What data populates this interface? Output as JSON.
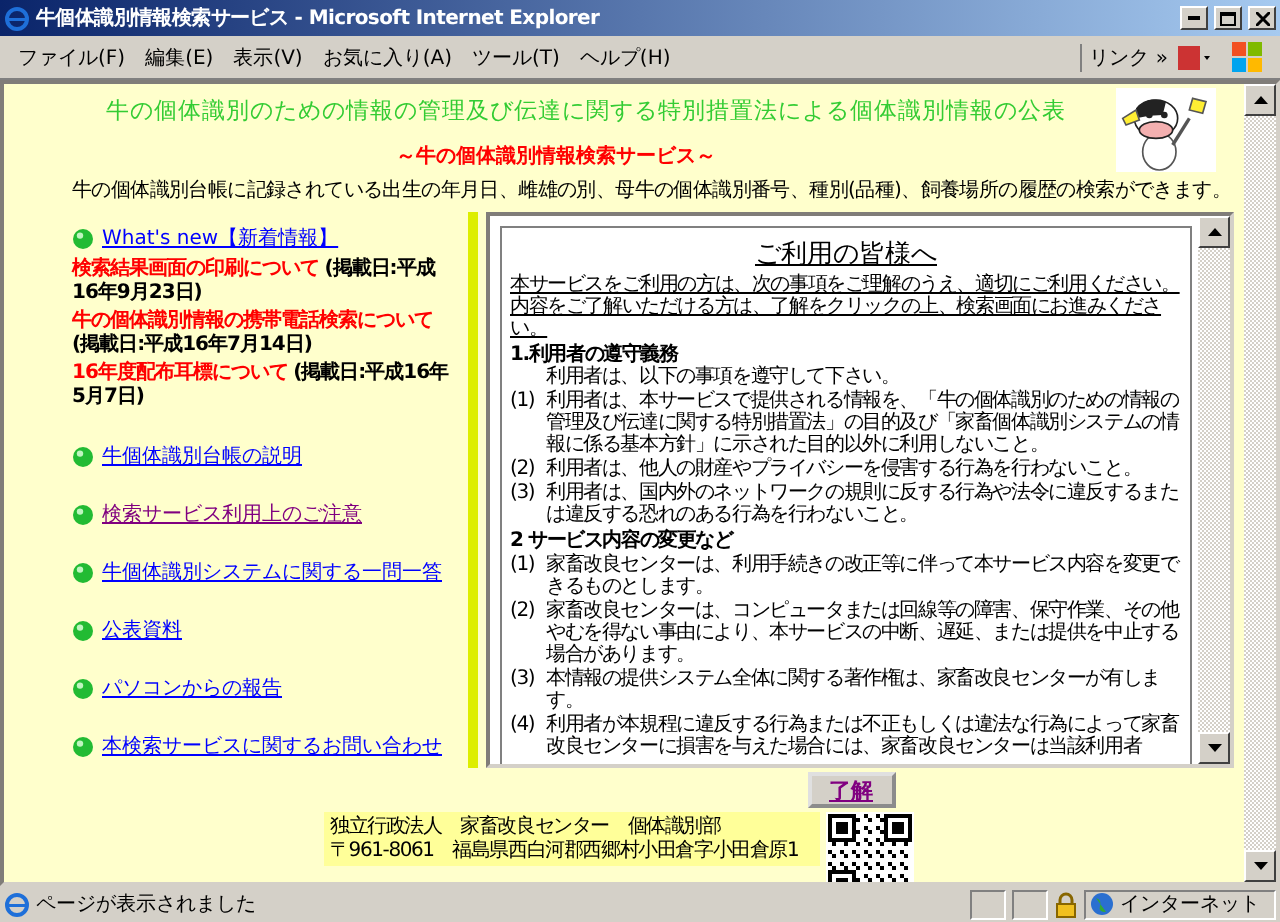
{
  "window": {
    "title": "牛個体識別情報検索サービス - Microsoft Internet Explorer"
  },
  "menu": {
    "items": [
      "ファイル(F)",
      "編集(E)",
      "表示(V)",
      "お気に入り(A)",
      "ツール(T)",
      "ヘルプ(H)"
    ],
    "links_label": "リンク",
    "chevron": "»"
  },
  "page": {
    "heading": "牛の個体識別のための情報の管理及び伝達に関する特別措置法による個体識別情報の公表",
    "subtitle": "～牛の個体識別情報検索サービス～",
    "description": "牛の個体識別台帳に記録されている出生の年月日、雌雄の別、母牛の個体識別番号、種別(品種)、飼養場所の履歴の検索ができます。",
    "news": {
      "link": "What's new【新着情報】",
      "items": [
        {
          "text": "検索結果画面の印刷について",
          "date": "(掲載日:平成16年9月23日)"
        },
        {
          "text": "牛の個体識別情報の携帯電話検索について",
          "date": "(掲載日:平成16年7月14日)"
        },
        {
          "text": "16年度配布耳標について",
          "date": "(掲載日:平成16年5月7日)"
        }
      ]
    },
    "links": [
      {
        "text": "牛個体識別台帳の説明",
        "visited": false
      },
      {
        "text": "検索サービス利用上のご注意",
        "visited": true
      },
      {
        "text": "牛個体識別システムに関する一問一答",
        "visited": false
      },
      {
        "text": "公表資料",
        "visited": false
      },
      {
        "text": "パソコンからの報告",
        "visited": false
      },
      {
        "text": "本検索サービスに関するお問い合わせ",
        "visited": false
      }
    ],
    "notice": {
      "title": "ご利用の皆様へ",
      "intro": "本サービスをご利用の方は、次の事項をご理解のうえ、適切にご利用ください。内容をご了解いただける方は、了解をクリックの上、検索画面にお進みください。",
      "sections": [
        {
          "heading": "1.利用者の遵守義務",
          "lead": "利用者は、以下の事項を遵守して下さい。",
          "items": [
            {
              "num": "(1)",
              "text": "利用者は、本サービスで提供される情報を、「牛の個体識別のための情報の管理及び伝達に関する特別措置法」の目的及び「家畜個体識別システムの情報に係る基本方針」に示された目的以外に利用しないこと。"
            },
            {
              "num": "(2)",
              "text": "利用者は、他人の財産やプライバシーを侵害する行為を行わないこと。"
            },
            {
              "num": "(3)",
              "text": "利用者は、国内外のネットワークの規則に反する行為や法令に違反するまたは違反する恐れのある行為を行わないこと。"
            }
          ]
        },
        {
          "heading": "2 サービス内容の変更など",
          "items": [
            {
              "num": "(1)",
              "text": "家畜改良センターは、利用手続きの改正等に伴って本サービス内容を変更できるものとします。"
            },
            {
              "num": "(2)",
              "text": "家畜改良センターは、コンピュータまたは回線等の障害、保守作業、その他やむを得ない事由により、本サービスの中断、遅延、または提供を中止する場合があります。"
            },
            {
              "num": "(3)",
              "text": "本情報の提供システム全体に関する著作権は、家畜改良センターが有します。"
            },
            {
              "num": "(4)",
              "text": "利用者が本規程に違反する行為または不正もしくは違法な行為によって家畜改良センターに損害を与えた場合には、家畜改良センターは当該利用者"
            }
          ]
        }
      ]
    },
    "agree_button": "了解",
    "footer": [
      "独立行政法人　家畜改良センター　個体識別部",
      "〒961-8061　福島県西白河郡西郷村小田倉字小田倉原1"
    ]
  },
  "status_bar": {
    "text": "ページが表示されました",
    "zone": "インターネット"
  }
}
